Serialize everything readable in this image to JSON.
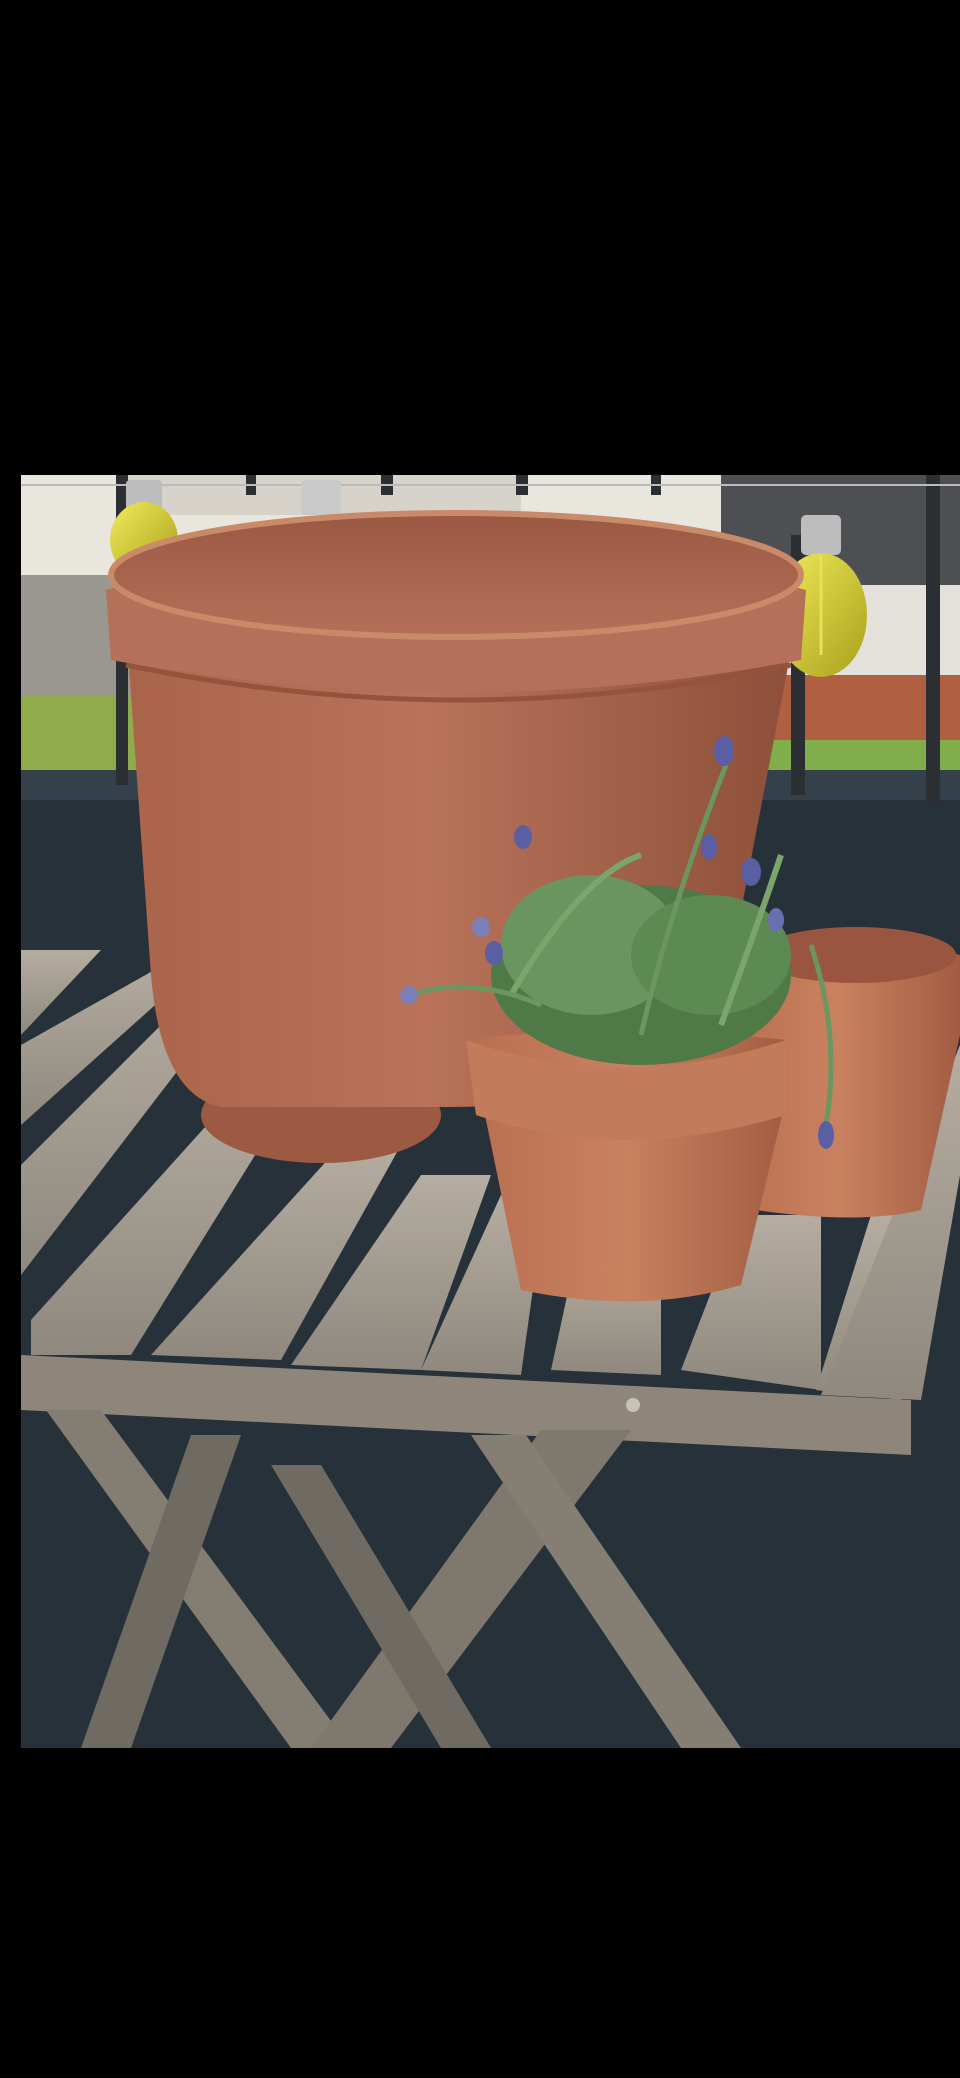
{
  "photo": {
    "subject": "terracotta-pots-and-lavender-on-wooden-balcony-table",
    "colors": {
      "sky": "#e9e6de",
      "railing": "#2b2f33",
      "wall": "#27313a",
      "terracotta": "#a8654a",
      "terracotta_light": "#c98a6a",
      "terracotta_dark": "#7e4733",
      "wood": "#a59d92",
      "wood_dark": "#6f6a62",
      "leaf": "#5f8a55",
      "lavender": "#5a5fa3",
      "bulb": "#d8d12a",
      "grass": "#7fae4a",
      "hedge": "#b5603c"
    }
  }
}
